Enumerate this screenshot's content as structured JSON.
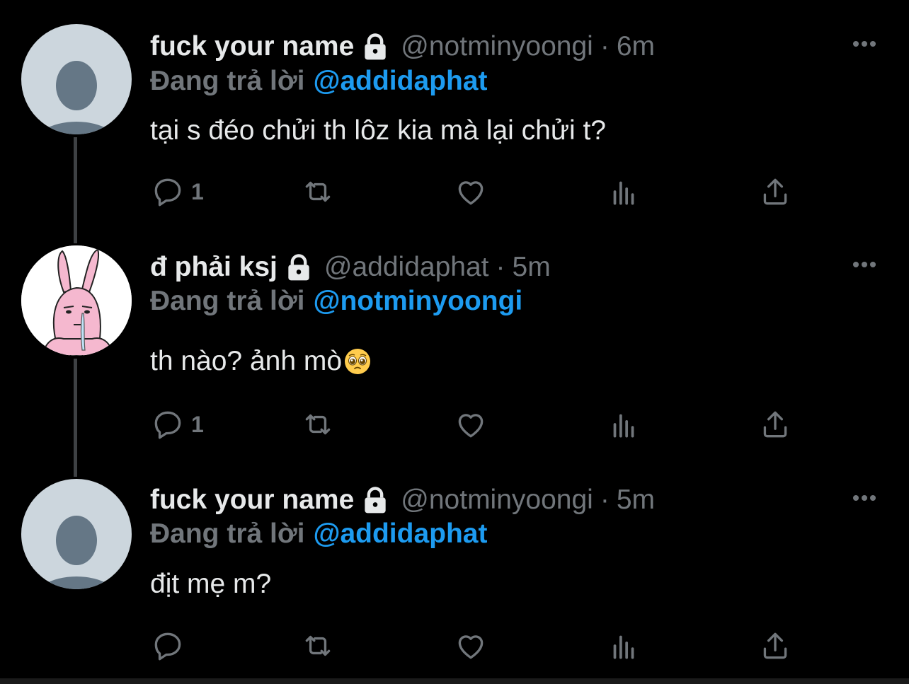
{
  "tweets": [
    {
      "display_name": "fuck your name",
      "handle": "@notminyoongi",
      "separator": "·",
      "time": "6m",
      "replying_label": "Đang trả lời",
      "replying_to": "@addidaphat",
      "text": "tại s đéo chửi th lôz kia mà lại chửi t?",
      "reply_count": "1",
      "avatar": "default-avatar",
      "protected_icon": "lock-icon"
    },
    {
      "display_name": "đ phải ksj",
      "handle": "@addidaphat",
      "separator": "·",
      "time": "5m",
      "replying_label": "Đang trả lời",
      "replying_to": "@notminyoongi",
      "text": "th nào? ảnh mò",
      "text_emoji": "pleading-face-emoji",
      "reply_count": "1",
      "avatar": "pink-bunny-avatar",
      "protected_icon": "lock-icon"
    },
    {
      "display_name": "fuck your name",
      "handle": "@notminyoongi",
      "separator": "·",
      "time": "5m",
      "replying_label": "Đang trả lời",
      "replying_to": "@addidaphat",
      "text": "địt mẹ m?",
      "reply_count": "",
      "avatar": "default-avatar",
      "protected_icon": "lock-icon"
    }
  ],
  "action_icons": [
    "reply-icon",
    "retweet-icon",
    "like-icon",
    "analytics-icon",
    "share-icon"
  ],
  "more_icon": "more-dots-icon",
  "colors": {
    "background": "#000000",
    "primary_text": "#e7e9ea",
    "secondary_text": "#71767b",
    "mention": "#1d9bf0",
    "thread_line": "#3e4144",
    "avatar_default_bg": "#ccd6dd",
    "avatar_default_fg": "#657786"
  }
}
